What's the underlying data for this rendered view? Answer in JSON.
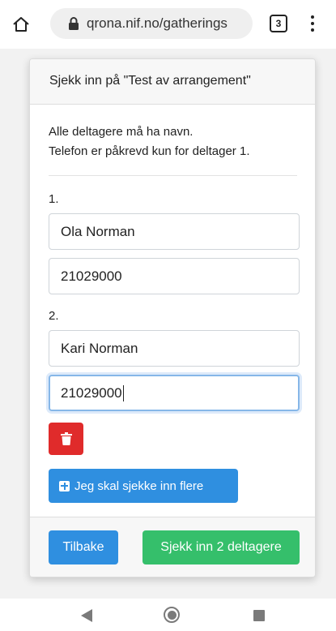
{
  "browser": {
    "url": "qrona.nif.no/gatherings",
    "tab_count": "3"
  },
  "checkin": {
    "header": "Sjekk inn på \"Test av arrangement\"",
    "instruction_line1": "Alle deltagere må ha navn.",
    "instruction_line2": "Telefon er påkrevd kun for deltager 1.",
    "participants": [
      {
        "number": "1.",
        "name": "Ola Norman",
        "phone": "21029000"
      },
      {
        "number": "2.",
        "name": "Kari Norman",
        "phone": "21029000"
      }
    ],
    "add_more_label": "Jeg skal sjekke inn flere",
    "back_label": "Tilbake",
    "submit_label": "Sjekk inn 2 deltagere"
  },
  "colors": {
    "primary": "#2f8fe0",
    "success": "#35bf6b",
    "danger": "#e02b2b"
  },
  "icons": [
    "home-icon",
    "lock-icon",
    "tabs-icon",
    "more-vert-icon",
    "trash-icon",
    "plus-square-icon",
    "back-triangle-icon",
    "home-circle-icon",
    "recents-square-icon"
  ]
}
